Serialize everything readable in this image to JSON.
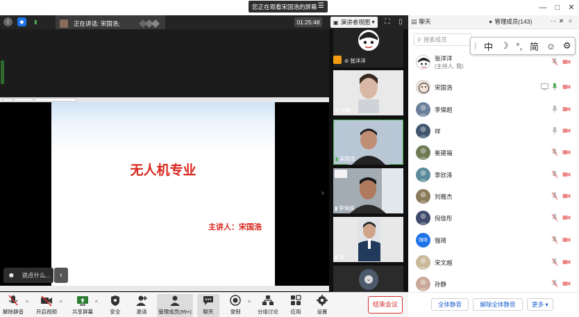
{
  "window": {
    "viewing_banner": "您正在观看宋国浩的屏幕",
    "minimize": "—",
    "maximize": "□",
    "close": "✕"
  },
  "topbar": {
    "speaking": "正在讲话: 宋国浩;",
    "timer": "01:25:48",
    "layout_label": "演讲者视图",
    "chat_tab": "聊天",
    "members_tab": "管理成员(143)",
    "more": "···",
    "close": "✕",
    "menu": "≡"
  },
  "slide": {
    "title": "无人机专业",
    "presenter": "主讲人：宋国浩"
  },
  "stage": {
    "chat_placeholder": "说点什么...",
    "collapse": "‹",
    "next_arrow": "›"
  },
  "tiles": [
    {
      "name": "张洋洋"
    },
    {
      "name": "孙静"
    },
    {
      "name": "宋国浩"
    },
    {
      "name": "李保超"
    },
    {
      "name": "祥"
    }
  ],
  "members": {
    "search_placeholder": "搜索成员",
    "list": [
      {
        "name": "张洋洋",
        "role": "(主持人, 我)",
        "mic": "muted",
        "cam": "off",
        "avatar_color": "#ffffff"
      },
      {
        "name": "宋国浩",
        "mic": "on",
        "cam": "off",
        "sharing": true,
        "avatar_color": "#f2e2d8"
      },
      {
        "name": "李保超",
        "mic": "on",
        "cam": "off",
        "avatar_color": "#6a7f99"
      },
      {
        "name": "祥",
        "mic": "on",
        "cam": "off",
        "avatar_color": "#40556e"
      },
      {
        "name": "崔建福",
        "mic": "muted",
        "cam": "off",
        "avatar_color": "#6f7a55"
      },
      {
        "name": "李欣泽",
        "mic": "muted",
        "cam": "off",
        "avatar_color": "#5b8a9a"
      },
      {
        "name": "刘雅杰",
        "mic": "muted",
        "cam": "off",
        "avatar_color": "#8a7a5a"
      },
      {
        "name": "倪佳彤",
        "mic": "muted",
        "cam": "off",
        "avatar_color": "#3d4a6b"
      },
      {
        "name": "强琦",
        "mic": "muted",
        "cam": "off",
        "avatar_text": "强琦",
        "avatar_color": "#1e73e8"
      },
      {
        "name": "宋文越",
        "mic": "muted",
        "cam": "off",
        "avatar_color": "#c9b89a"
      },
      {
        "name": "孙静",
        "mic": "muted",
        "cam": "off",
        "avatar_color": "#caa99a"
      }
    ],
    "mute_all": "全体静音",
    "unmute_all": "解除全体静音",
    "more": "更多 ▾"
  },
  "ime": {
    "mode": "中",
    "moon": "☽",
    "punct": "°,",
    "simplified": "简",
    "emoji": "☺",
    "settings": "⚙"
  },
  "toolbar": {
    "unmute": "解除静音",
    "start_video": "开启视频",
    "share_screen": "共享屏幕",
    "security": "安全",
    "invite": "邀请",
    "manage_members": "管理成员(99+)",
    "chat": "聊天",
    "record": "录制",
    "breakout": "分组讨论",
    "apps": "应用",
    "settings": "设置",
    "end_meeting": "结束会议",
    "caret": "^"
  },
  "colors": {
    "accent_blue": "#1a5fd0",
    "danger_red": "#d32f2f",
    "slide_red": "#d8261d",
    "active_green": "#4caf50"
  }
}
